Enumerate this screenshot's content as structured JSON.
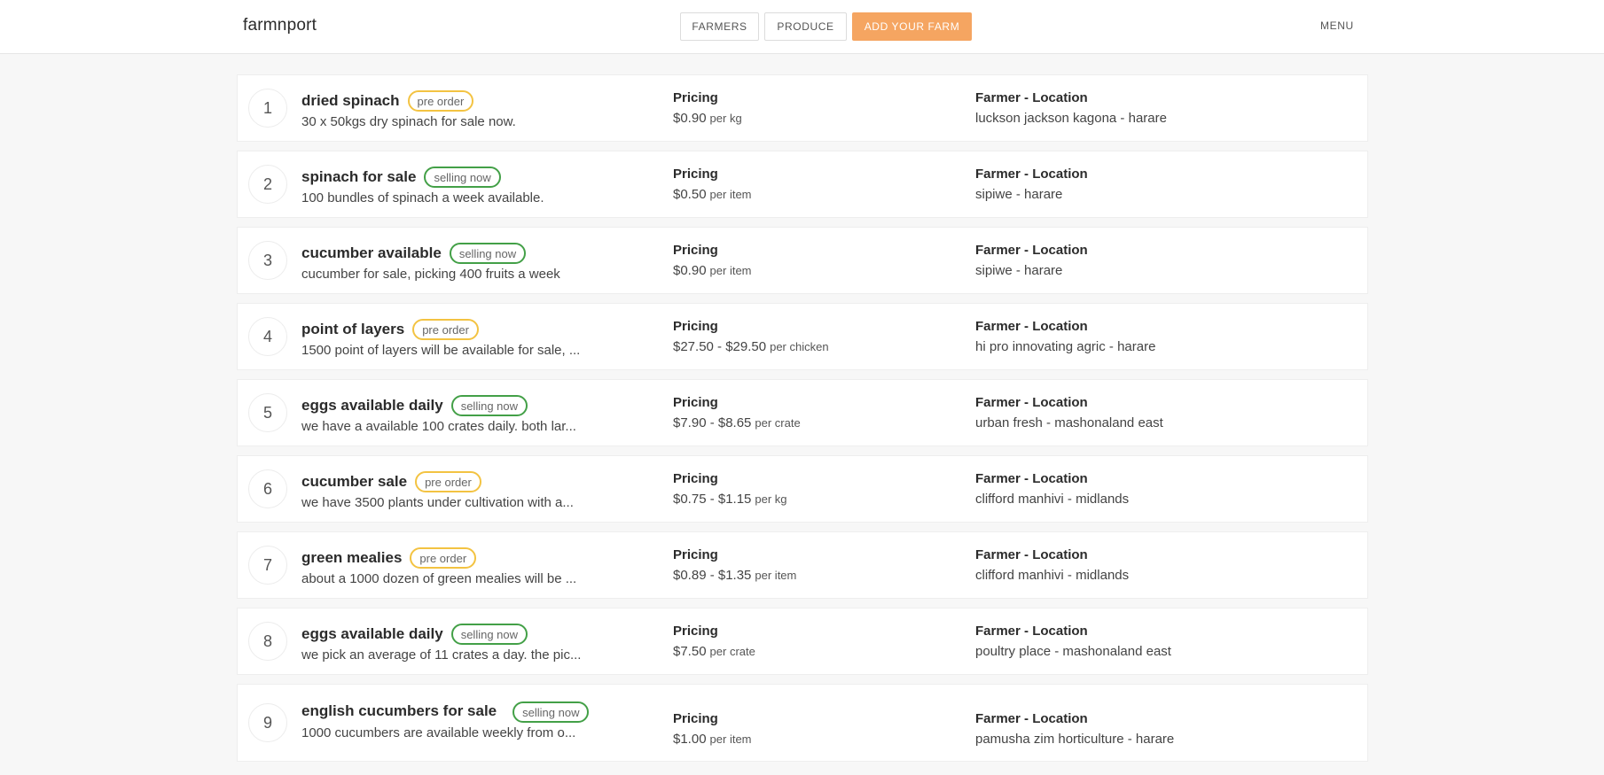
{
  "header": {
    "brand": "farmnport",
    "nav": {
      "farmers": "FARMERS",
      "produce": "PRODUCE",
      "add_farm": "ADD YOUR FARM"
    },
    "menu": "MENU"
  },
  "labels": {
    "pricing": "Pricing",
    "farmer_location": "Farmer - Location"
  },
  "colors": {
    "accent": "#f5a561",
    "pre_order": "#f3c342",
    "selling_now": "#43a047"
  },
  "listings": [
    {
      "num": "1",
      "title": "dried spinach",
      "badge": "pre order",
      "status": "pre",
      "desc": "30 x 50kgs dry spinach for sale now.",
      "price": "$0.90",
      "unit": "per kg",
      "farmer": "luckson jackson kagona - harare"
    },
    {
      "num": "2",
      "title": "spinach for sale",
      "badge": "selling now",
      "status": "sell",
      "desc": "100 bundles of spinach a week available.",
      "price": "$0.50",
      "unit": "per item",
      "farmer": "sipiwe - harare"
    },
    {
      "num": "3",
      "title": "cucumber available",
      "badge": "selling now",
      "status": "sell",
      "desc": "cucumber for sale, picking 400 fruits a week",
      "price": "$0.90",
      "unit": "per item",
      "farmer": "sipiwe - harare"
    },
    {
      "num": "4",
      "title": "point of layers",
      "badge": "pre order",
      "status": "pre",
      "desc": "1500 point of layers will be available for sale, ...",
      "price": "$27.50 - $29.50",
      "unit": "per chicken",
      "farmer": "hi pro innovating agric - harare"
    },
    {
      "num": "5",
      "title": "eggs available daily",
      "badge": "selling now",
      "status": "sell",
      "desc": "we have a available 100 crates daily. both lar...",
      "price": "$7.90 - $8.65",
      "unit": "per crate",
      "farmer": "urban fresh - mashonaland east"
    },
    {
      "num": "6",
      "title": "cucumber sale",
      "badge": "pre order",
      "status": "pre",
      "desc": "we have 3500 plants under cultivation with a...",
      "price": "$0.75 - $1.15",
      "unit": "per kg",
      "farmer": "clifford manhivi - midlands"
    },
    {
      "num": "7",
      "title": "green mealies",
      "badge": "pre order",
      "status": "pre",
      "desc": "about a 1000 dozen of green mealies will be ...",
      "price": "$0.89 - $1.35",
      "unit": "per item",
      "farmer": "clifford manhivi - midlands"
    },
    {
      "num": "8",
      "title": "eggs available daily",
      "badge": "selling now",
      "status": "sell",
      "desc": "we pick an average of 11 crates a day. the pic...",
      "price": "$7.50",
      "unit": "per crate",
      "farmer": "poultry place - mashonaland east"
    },
    {
      "num": "9",
      "title": "english cucumbers for sale",
      "badge": "selling now",
      "status": "sell",
      "desc": "1000 cucumbers are available weekly from o...",
      "price": "$1.00",
      "unit": "per item",
      "farmer": "pamusha zim horticulture - harare"
    }
  ]
}
